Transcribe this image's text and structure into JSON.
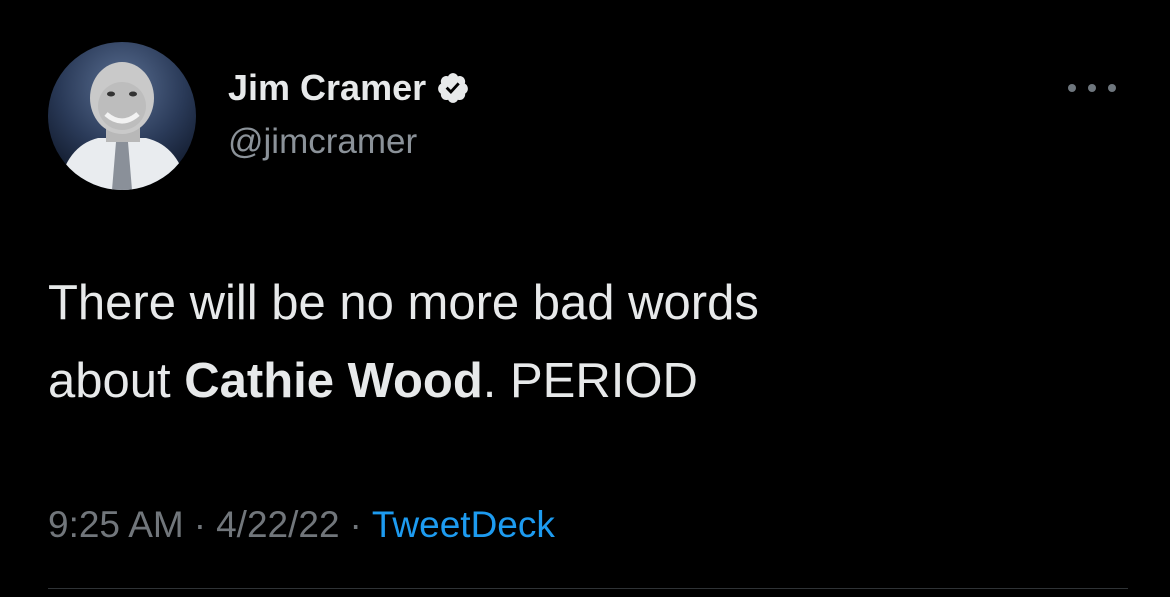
{
  "author": {
    "display_name": "Jim Cramer",
    "handle": "@jimcramer",
    "verified": true
  },
  "tweet": {
    "text_part1": "There will be no more bad words",
    "text_part2": "about ",
    "bold_mention": "Cathie Wood",
    "text_part3": ". PERIOD",
    "time": "9:25 AM",
    "date": "4/22/22",
    "source": "TweetDeck",
    "separator": "·"
  },
  "icons": {
    "verified": "verified-badge-icon",
    "more": "more-options-icon"
  },
  "colors": {
    "background": "#000000",
    "text_primary": "#e7e9ea",
    "text_secondary": "#71767b",
    "accent": "#1d9bf0"
  }
}
